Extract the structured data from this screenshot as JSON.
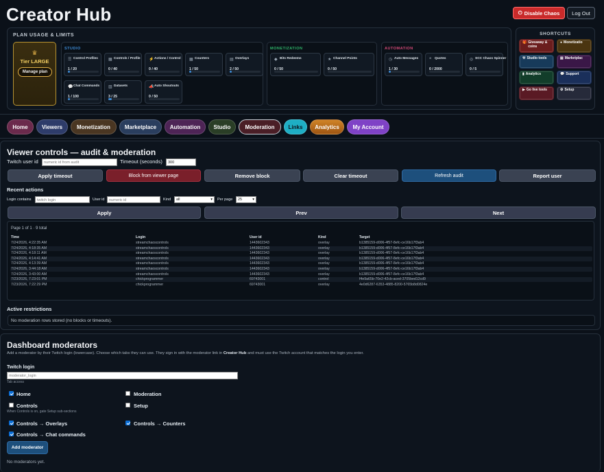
{
  "header": {
    "title": "Creator Hub",
    "disable_chaos": "Disable Chaos",
    "logout": "Log Out"
  },
  "plan": {
    "title": "PLAN USAGE & LIMITS",
    "tier": {
      "name": "Tier LARGE",
      "manage": "Manage plan"
    },
    "studio": {
      "label": "STUDIO",
      "tiles": [
        {
          "name": "Control Profiles",
          "value": "1 / 20",
          "fill": 0.05,
          "icon": "sliders-icon"
        },
        {
          "name": "Controls / Profile",
          "value": "0 / 40",
          "fill": 0,
          "icon": "panel-icon"
        },
        {
          "name": "Actions / Control",
          "value": "0 / 40",
          "fill": 0,
          "icon": "bolt-icon"
        },
        {
          "name": "Counters",
          "value": "1 / 50",
          "fill": 0.02,
          "icon": "grid-icon"
        },
        {
          "name": "Overlays",
          "value": "2 / 50",
          "fill": 0.04,
          "icon": "layers-icon"
        },
        {
          "name": "Chat Commands",
          "value": "1 / 100",
          "fill": 0.01,
          "icon": "chat-icon"
        },
        {
          "name": "Datasets",
          "value": "3 / 25",
          "fill": 0.12,
          "icon": "table-icon"
        },
        {
          "name": "Auto Shoutouts",
          "value": "0 / 50",
          "fill": 0,
          "icon": "megaphone-icon"
        }
      ]
    },
    "monetization": {
      "label": "MONETIZATION",
      "tiles": [
        {
          "name": "Bits Redeems",
          "value": "0 / 50",
          "fill": 0,
          "icon": "diamond-icon"
        },
        {
          "name": "Channel Points",
          "value": "0 / 50",
          "fill": 0,
          "icon": "star-icon"
        }
      ]
    },
    "automation": {
      "label": "AUTOMATION",
      "tiles": [
        {
          "name": "Auto Messages",
          "value": "1 / 30",
          "fill": 0.03,
          "icon": "clock-icon"
        },
        {
          "name": "Quotes",
          "value": "0 / 2000",
          "fill": 0,
          "icon": "quote-icon"
        },
        {
          "name": "SCC Chaos Spinner",
          "value": "0 / 5",
          "fill": 0,
          "icon": "spinner-icon"
        }
      ]
    }
  },
  "shortcuts": {
    "title": "SHORTCUTS",
    "items": [
      {
        "label": "Giveaway & coins",
        "icon": "gift-icon",
        "color": "#6b1d1d"
      },
      {
        "label": "Monetizatio",
        "icon": "coin-icon",
        "color": "#4a3510"
      },
      {
        "label": "Studio tools",
        "icon": "tools-icon",
        "color": "#173a5a"
      },
      {
        "label": "Marketplac",
        "icon": "store-icon",
        "color": "#3a1747"
      },
      {
        "label": "Analytics",
        "icon": "chart-icon",
        "color": "#123d2a"
      },
      {
        "label": "Support",
        "icon": "chat-icon",
        "color": "#1a2f5a"
      },
      {
        "label": "Go live tools",
        "icon": "live-icon",
        "color": "#5a1a24"
      },
      {
        "label": "Setup",
        "icon": "gear-icon",
        "color": "#262a3a"
      }
    ]
  },
  "tabs": [
    {
      "label": "Home",
      "color": "#6b2a4c",
      "width": 39
    },
    {
      "label": "Viewers",
      "color": "#2e3c6a",
      "width": 46
    },
    {
      "label": "Monetization",
      "color": "#4a3622",
      "width": 67
    },
    {
      "label": "Marketplace",
      "color": "#2a3e5e",
      "width": 62
    },
    {
      "label": "Automation",
      "color": "#4e2456",
      "width": 60
    },
    {
      "label": "Studio",
      "color": "#2a3e26",
      "width": 40
    },
    {
      "label": "Moderation",
      "color": "#4a1e26",
      "width": 62
    },
    {
      "label": "Links",
      "color": "#1eaec4",
      "width": 34
    },
    {
      "label": "Analytics",
      "color": "#c2741c",
      "width": 50
    },
    {
      "label": "My Account",
      "color": "#7f42c6",
      "width": 62
    }
  ],
  "viewer_controls": {
    "title": "Viewer controls — audit & moderation",
    "user_id_label": "Twitch user id",
    "user_id_placeholder": "numeric id from audit",
    "timeout_label": "Timeout (seconds)",
    "timeout_value": "300",
    "actions": [
      "Apply timeout",
      "Block from viewer page",
      "Remove block",
      "Clear timeout",
      "Refresh audit",
      "Report user"
    ],
    "recent_title": "Recent actions",
    "filters": {
      "login_label": "Login contains",
      "login_placeholder": "twitch login",
      "userid_label": "User id",
      "userid_placeholder": "numeric id",
      "kind_label": "Kind",
      "kind_value": "all",
      "perpage_label": "Per page",
      "perpage_value": "25"
    },
    "nav": {
      "apply": "Apply",
      "prev": "Prev",
      "next": "Next"
    },
    "audit": {
      "page_info": "Page 1 of 1 · 9 total",
      "headers": [
        "Time",
        "Login",
        "User id",
        "Kind",
        "Target"
      ],
      "rows": [
        [
          "7/24/2026, 4:22:35 AM",
          "streamchaoscontrols",
          "1443602343",
          "overlay",
          "b1385159-d006-4f57-8efc-ce16b17f3ab4"
        ],
        [
          "7/24/2026, 4:18:35 AM",
          "streamchaoscontrols",
          "1443602343",
          "overlay",
          "b1385159-d006-4f57-8efc-ce16b17f3ab4"
        ],
        [
          "7/24/2026, 4:18:11 AM",
          "streamchaoscontrols",
          "1443602343",
          "overlay",
          "b1385159-d006-4f57-8efc-ce16b17f3ab4"
        ],
        [
          "7/24/2026, 4:14:41 AM",
          "streamchaoscontrols",
          "1443602343",
          "overlay",
          "b1385159-d006-4f57-8efc-ce16b17f3ab4"
        ],
        [
          "7/24/2026, 4:13:39 AM",
          "streamchaoscontrols",
          "1443602343",
          "overlay",
          "b1385159-d006-4f57-8efc-ce16b17f3ab4"
        ],
        [
          "7/24/2026, 3:44:18 AM",
          "streamchaoscontrols",
          "1443602343",
          "overlay",
          "b1385159-d006-4f57-8efc-ce16b17f3ab4"
        ],
        [
          "7/24/2026, 3:43:00 AM",
          "streamchaoscontrols",
          "1443602343",
          "overlay",
          "b1385159-d006-4f57-8efc-ce16b17f3ab4"
        ],
        [
          "7/23/2026, 7:23:01 PM",
          "chickprogrammer",
          "69743001",
          "control",
          "f4e9a65b-70e2-42cb-aced-3705bed12cd9"
        ],
        [
          "7/23/2026, 7:22:29 PM",
          "chickprogrammer",
          "69743001",
          "overlay",
          "4e0d6287-6353-4885-8200-5765b8d0824e"
        ]
      ]
    },
    "restrictions_title": "Active restrictions",
    "restrictions_empty": "No moderation rows stored (no blocks or timeouts)."
  },
  "dashboard_mods": {
    "title": "Dashboard moderators",
    "desc_1": "Add a moderator by their Twitch login (lowercase). Choose which tabs they can use. They sign in with the moderator link in ",
    "desc_bold": "Creator Hub",
    "desc_2": " and must use the Twitch account that matches the login you enter.",
    "login_label": "Twitch login",
    "login_placeholder": "moderator_login",
    "tab_access": "Tab access",
    "checks": [
      {
        "label": "Home",
        "on": true
      },
      {
        "label": "Moderation",
        "on": false
      },
      {
        "label": "Controls",
        "on": false
      },
      {
        "label": "Setup",
        "on": false
      },
      {
        "label": "Controls → Overlays",
        "on": true
      },
      {
        "label": "Controls → Counters",
        "on": true
      },
      {
        "label": "Controls → Chat commands",
        "on": true
      }
    ],
    "controls_note": "When Controls is on, gate Setup sub-sections",
    "add_button": "Add moderator",
    "empty": "No moderators yet."
  }
}
